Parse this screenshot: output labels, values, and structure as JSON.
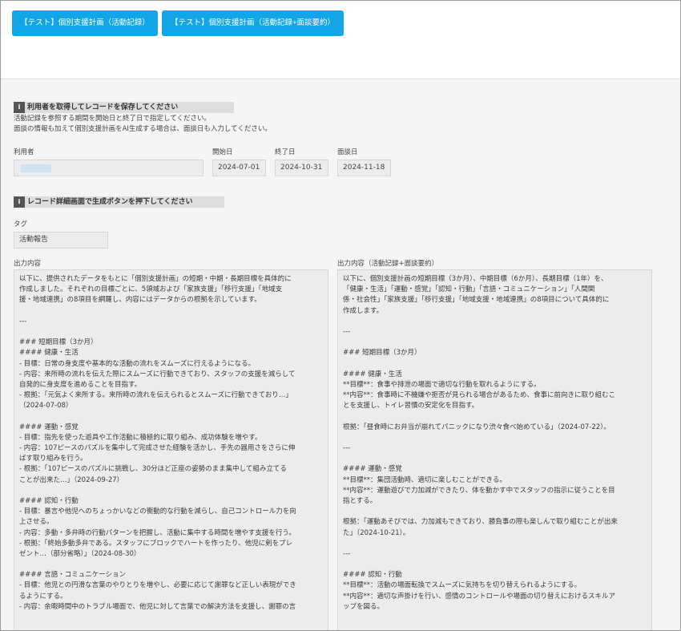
{
  "buttons": {
    "btn1": "【テスト】個別支援計画（活動記録）",
    "btn2": "【テスト】個別支援計画（活動記録+面談要約）"
  },
  "section1": {
    "title": "利用者を取得してレコードを保存してください",
    "note1": "活動記録を参照する期間を開始日と終了日で指定してください。",
    "note2": "面談の情報も加えて個別支援計画をAI生成する場合は、面談日も入力してください。"
  },
  "fields": {
    "user_label": "利用者",
    "start_label": "開始日",
    "start_value": "2024-07-01",
    "end_label": "終了日",
    "end_value": "2024-10-31",
    "interview_label": "面談日",
    "interview_value": "2024-11-18"
  },
  "section2": {
    "title": "レコード詳細画面で生成ボタンを押下してください"
  },
  "tag": {
    "label": "タグ",
    "value": "活動報告"
  },
  "output_left": {
    "label": "出力内容",
    "lines": [
      "以下に、提供されたデータをもとに「個別支援計画」の短期・中期・長期目標を具体的に",
      "作成しました。それぞれの目標ごとに、5領域および「家族支援」「移行支援」「地域支",
      "援・地域連携」の8項目を網羅し、内容にはデータからの根拠を示しています。",
      "",
      "---",
      "",
      "### 短期目標（3か月）",
      "#### 健康・生活",
      "- 目標：日常の身支度や基本的な活動の流れをスムーズに行えるようになる。",
      "- 内容：来所時の流れを伝えた際にスムーズに行動できており、スタッフの支援を減らして",
      "自発的に身支度を進めることを目指す。",
      "- 根拠：「元気よく来所する。来所時の流れを伝えられるとスムーズに行動できており…」",
      "（2024-07-08）",
      "",
      "#### 運動・感覚",
      "- 目標：指先を使った遊具や工作活動に積極的に取り組み、成功体験を増やす。",
      "- 内容：107ピースのパズルを集中して完成させた経験を活かし、手先の器用さをさらに伸",
      "ばす取り組みを行う。",
      "- 根拠：「107ピースのパズルに挑戦し、30分ほど正座の姿勢のまま集中して組み立てる",
      "ことが出来た…」（2024-09-27）",
      "",
      "#### 認知・行動",
      "- 目標：暴言や他児へのちょっかいなどの衝動的な行動を減らし、自己コントロール力を向",
      "上させる。",
      "- 内容：多動・多弁時の行動パターンを把握し、活動に集中する時間を増やす支援を行う。",
      "- 根拠：「終始多動多弁である。スタッフにブロックでハートを作ったり、他児に剣をプレ",
      "ゼント…（部分省略）」（2024-08-30）",
      "",
      "#### 言語・コミュニケーション",
      "- 目標：他児との円滑な言葉のやりとりを増やし、必要に応じて謝罪など正しい表現ができ",
      "るようにする。",
      "- 内容：余暇時間中のトラブル場面で、他児に対して言葉での解決方法を支援し、謝罪の言"
    ]
  },
  "output_right": {
    "label": "出力内容（活動記録+面談要約）",
    "lines": [
      "以下に、個別支援計画の短期目標（3か月）、中期目標（6か月）、長期目標（1年）を、",
      "「健康・生活」「運動・感覚」「認知・行動」「言語・コミュニケーション」「人間関",
      "係・社会性」「家族支援」「移行支援」「地域支援・地域連携」の8項目について具体的に",
      "作成します。",
      "",
      "---",
      "",
      "### 短期目標（3か月）",
      "",
      "#### 健康・生活",
      "**目標**：食事や排泄の場面で適切な行動を取れるようにする。",
      "**内容**：食事時に不機嫌や拒否が見られる場合があるため、食事に前向きに取り組むこ",
      "とを支援し、トイレ習慣の安定化を目指す。",
      "",
      "根拠：「昼食時にお弁当が崩れてパニックになり渋々食べ始めている」（2024-07-22）。",
      "",
      "---",
      "",
      "#### 運動・感覚",
      "**目標**：集団活動時、適切に楽しむことができる。",
      "**内容**：運動遊びで力加減ができたり、体を動かす中でスタッフの指示に従うことを目",
      "指とする。",
      "",
      "根拠：「運動あそびでは、力加減もできており、勝負事の際も楽しんで取り組むことが出来",
      "た」（2024-10-21）。",
      "",
      "---",
      "",
      "#### 認知・行動",
      "**目標**：活動の場面転換でスムーズに気持ちを切り替えられるようにする。",
      "**内容**：適切な声掛けを行い、感情のコントロールや場面の切り替えにおけるスキルア",
      "ップを図る。"
    ]
  }
}
